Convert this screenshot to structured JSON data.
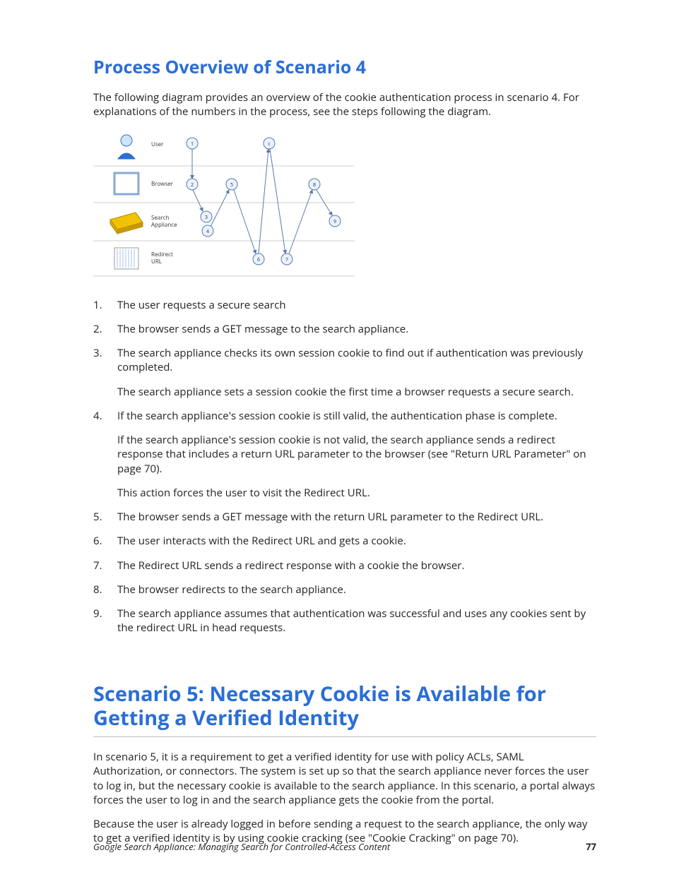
{
  "heading_scenario4": "Process Overview of Scenario 4",
  "intro_scenario4": "The following diagram provides an overview of the cookie authentication process in scenario 4. For explanations of the numbers in the process, see the steps following the diagram.",
  "diagram": {
    "lanes": [
      "User",
      "Browser",
      "Search Appliance",
      "Redirect URL"
    ],
    "nodes": [
      "1",
      "2",
      "3",
      "4",
      "5",
      "6",
      "7",
      "8",
      "9",
      "c"
    ]
  },
  "steps": [
    {
      "n": "1.",
      "text": "The user requests a secure search"
    },
    {
      "n": "2.",
      "text": "The browser sends a GET message to the search appliance."
    },
    {
      "n": "3.",
      "text": "The search appliance checks its own session cookie to find out if authentication was previously completed.",
      "sub": [
        "The search appliance sets a session cookie the first time a browser requests a secure search."
      ]
    },
    {
      "n": "4.",
      "text": "If the search appliance's session cookie is still valid, the authentication phase is complete.",
      "sub": [
        "If the search appliance's session cookie is not valid, the search appliance sends a redirect response that includes a return URL parameter to the browser (see \"Return URL Parameter\" on page 70).",
        "This action forces the user to visit the Redirect URL."
      ]
    },
    {
      "n": "5.",
      "text": "The browser sends a GET message with the return URL parameter to the Redirect URL."
    },
    {
      "n": "6.",
      "text": "The user interacts with the Redirect URL and gets a cookie."
    },
    {
      "n": "7.",
      "text": "The Redirect URL sends a redirect response with a cookie the browser."
    },
    {
      "n": "8.",
      "text": "The browser redirects to the search appliance."
    },
    {
      "n": "9.",
      "text": "The search appliance assumes that authentication was successful and uses any cookies sent by the redirect URL in head requests."
    }
  ],
  "heading_scenario5": "Scenario 5: Necessary Cookie is Available for Getting a Verified Identity",
  "scenario5_p1": "In scenario 5, it is a requirement to get a verified identity for use with policy ACLs, SAML Authorization, or connectors. The system is set up so that the search appliance never forces the user to log in, but the necessary cookie is available to the search appliance. In this scenario, a portal always forces the user to log in and the search appliance gets the cookie from the portal.",
  "scenario5_p2": "Because the user is already logged in before sending a request to the search appliance, the only way to get a verified identity is by using cookie cracking (see \"Cookie Cracking\" on page 70).",
  "footer_title": "Google Search Appliance: Managing Search for Controlled-Access Content",
  "footer_page": "77"
}
